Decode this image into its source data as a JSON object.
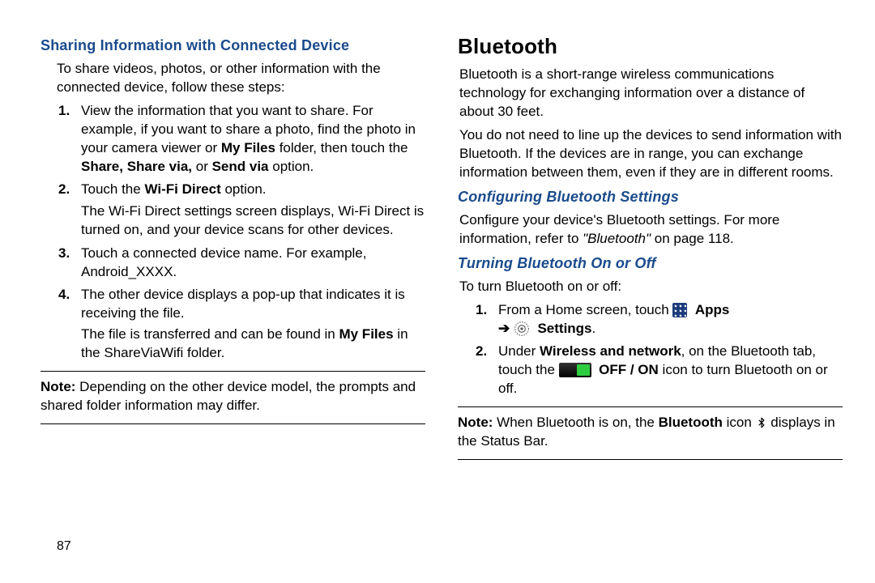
{
  "page_number": "87",
  "left": {
    "h2": "Sharing Information with Connected Device",
    "intro": "To share videos, photos, or other information with the connected device, follow these steps:",
    "steps": [
      {
        "num": "1.",
        "parts": [
          "View the information that you want to share. For example, if you want to share a photo, find the photo in your camera viewer or ",
          {
            "b": "My Files"
          },
          " folder, then touch the ",
          {
            "b": "Share, Share via,"
          },
          " or ",
          {
            "b": "Send via"
          },
          " option."
        ]
      },
      {
        "num": "2.",
        "parts": [
          "Touch the ",
          {
            "b": "Wi-Fi Direct"
          },
          " option."
        ],
        "after": "The Wi-Fi Direct settings screen displays, Wi-Fi Direct is turned on, and your device scans for other devices."
      },
      {
        "num": "3.",
        "parts": [
          "Touch a connected device name. For example, Android_XXXX."
        ]
      },
      {
        "num": "4.",
        "parts": [
          "The other device displays a pop-up that indicates it is receiving the file."
        ],
        "after_parts": [
          "The file is transferred and can be found in ",
          {
            "b": "My Files"
          },
          " in the ShareViaWifi folder."
        ]
      }
    ],
    "note_label": "Note:",
    "note_text": " Depending on the other device model, the prompts and shared folder information may differ."
  },
  "right": {
    "h1": "Bluetooth",
    "intro1": "Bluetooth is a short-range wireless communications technology for exchanging information over a distance of about 30 feet.",
    "intro2": "You do not need to line up the devices to send information with Bluetooth. If the devices are in range, you can exchange information between them, even if they are in different rooms.",
    "h2a": "Configuring Bluetooth Settings",
    "cfg_parts": [
      "Configure your device's Bluetooth settings. For more information, refer to ",
      {
        "i": "\"Bluetooth\""
      },
      " on page 118."
    ],
    "h2b": "Turning Bluetooth On or Off",
    "turn_intro": "To turn Bluetooth on or off:",
    "steps": [
      {
        "num": "1.",
        "line1_parts": [
          "From a Home screen, touch "
        ],
        "apps_label": "Apps",
        "arrow": "➔",
        "settings_label": "Settings",
        "period": "."
      },
      {
        "num": "2.",
        "parts_a": [
          "Under ",
          {
            "b": "Wireless and network"
          },
          ", on the Bluetooth tab, touch the "
        ],
        "toggle_label": "OFF / ON",
        "parts_b": [
          " icon to turn Bluetooth on or off."
        ]
      }
    ],
    "note_label": "Note:",
    "note_parts_a": " When Bluetooth is on, the ",
    "note_bold": "Bluetooth",
    "note_parts_b": " icon ",
    "note_parts_c": " displays in the Status Bar."
  }
}
